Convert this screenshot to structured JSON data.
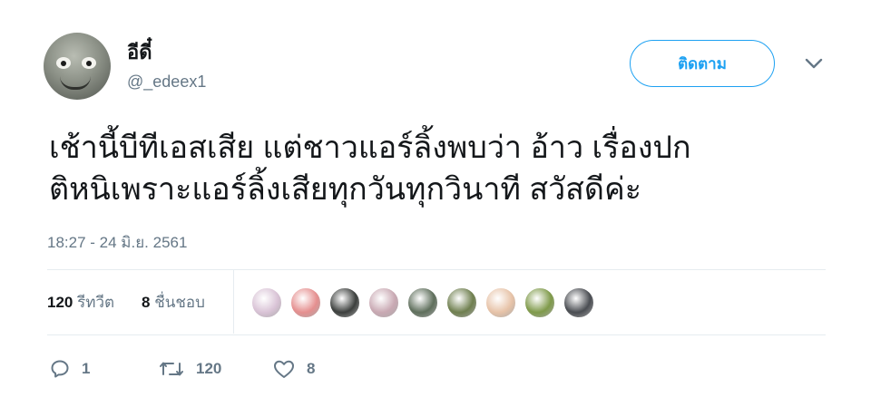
{
  "author": {
    "display_name": "อีดี๋",
    "handle": "@_edeex1"
  },
  "follow_button": {
    "label": "ติดตาม"
  },
  "tweet": {
    "lines": [
      "เช้านี้บีทีเอสเสีย แต่ชาวแอร์ลิ้งพบว่า อ้าว เรื่องปก",
      "ติหนิเพราะแอร์ลิ้งเสียทุกวันทุกวินาที สวัสดีค่ะ"
    ],
    "timestamp": "18:27 - 24 มิ.ย. 2561"
  },
  "stats": {
    "retweets_count": "120",
    "retweets_label": "รีทวีต",
    "likes_count": "8",
    "likes_label": "ชื่นชอบ"
  },
  "likers": [
    {
      "color": "#d9c3d6"
    },
    {
      "color": "#e58f8f"
    },
    {
      "color": "#3c3f3d"
    },
    {
      "color": "#c9a9b3"
    },
    {
      "color": "#5f6f5c"
    },
    {
      "color": "#6f7f4f"
    },
    {
      "color": "#e7c3a8"
    },
    {
      "color": "#7f9a4a"
    },
    {
      "color": "#4a4d52"
    }
  ],
  "actions": {
    "reply_count": "1",
    "retweet_count": "120",
    "like_count": "8"
  },
  "icons": {
    "reply": "reply-icon",
    "retweet": "retweet-icon",
    "like": "heart-icon",
    "menu": "chevron-down-icon"
  },
  "colors": {
    "accent": "#1da1f2",
    "muted": "#657786",
    "divider": "#e6ecf0"
  }
}
